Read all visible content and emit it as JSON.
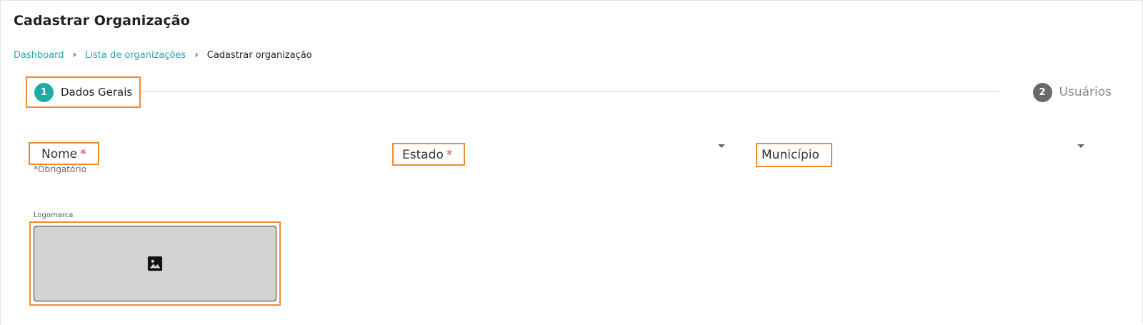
{
  "page": {
    "title": "Cadastrar Organização"
  },
  "breadcrumb": {
    "items": [
      "Dashboard",
      "Lista de organizações",
      "Cadastrar organização"
    ],
    "separator": "›"
  },
  "stepper": {
    "steps": [
      {
        "number": "1",
        "label": "Dados Gerais",
        "active": true
      },
      {
        "number": "2",
        "label": "Usuários",
        "active": false
      }
    ]
  },
  "form": {
    "nome": {
      "label": "Nome",
      "required_mark": "*"
    },
    "estado": {
      "label": "Estado",
      "required_mark": "*"
    },
    "municipio": {
      "label": "Município"
    },
    "required_hint": "*Obrigatório",
    "logo": {
      "label": "Logomarca",
      "icon": "image-icon"
    }
  },
  "colors": {
    "accent": "#26a5a9",
    "step_active": "#1eaba6",
    "step_inactive": "#6a6a6a",
    "highlight": "#f08a2e",
    "required": "#e53935"
  }
}
